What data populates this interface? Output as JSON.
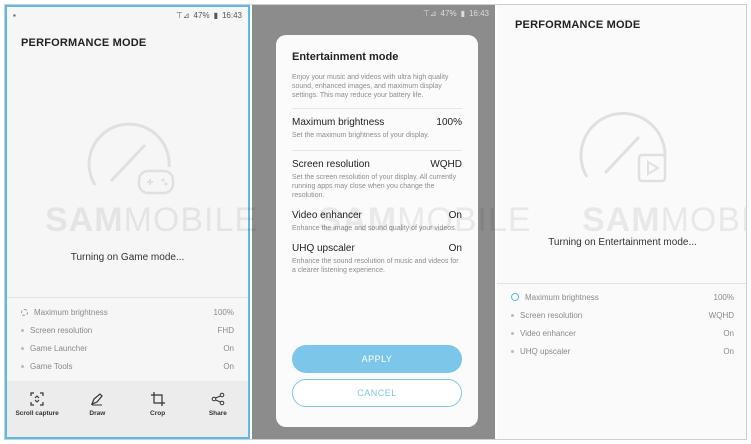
{
  "panel1": {
    "status": {
      "signal": "⊤⊿",
      "battery": "47%",
      "time": "16:43"
    },
    "title": "PERFORMANCE MODE",
    "message": "Turning on Game mode...",
    "list": [
      {
        "label": "Maximum brightness",
        "value": "100%"
      },
      {
        "label": "Screen resolution",
        "value": "FHD"
      },
      {
        "label": "Game Launcher",
        "value": "On"
      },
      {
        "label": "Game Tools",
        "value": "On"
      }
    ],
    "bottom_bar": [
      {
        "label": "Scroll capture",
        "icon": "scroll-capture-icon"
      },
      {
        "label": "Draw",
        "icon": "draw-icon"
      },
      {
        "label": "Crop",
        "icon": "crop-icon"
      },
      {
        "label": "Share",
        "icon": "share-icon"
      }
    ]
  },
  "panel2": {
    "status": {
      "battery": "47%",
      "time": "16:43"
    },
    "dialog": {
      "title": "Entertainment mode",
      "description": "Enjoy your music and videos with ultra high quality sound, enhanced images, and maximum display settings. This may reduce your battery life.",
      "settings": [
        {
          "label": "Maximum brightness",
          "value": "100%",
          "desc": "Set the maximum brightness of your display."
        },
        {
          "label": "Screen resolution",
          "value": "WQHD",
          "desc": "Set the screen resolution of your display. All currently running apps may close when you change the resolution."
        },
        {
          "label": "Video enhancer",
          "value": "On",
          "desc": "Enhance the image and sound quality of your videos."
        },
        {
          "label": "UHQ upscaler",
          "value": "On",
          "desc": "Enhance the sound resolution of music and videos for a clearer listening experience."
        }
      ],
      "apply": "APPLY",
      "cancel": "CANCEL"
    }
  },
  "panel3": {
    "title": "PERFORMANCE MODE",
    "message": "Turning on Entertainment mode...",
    "list": [
      {
        "label": "Maximum brightness",
        "value": "100%"
      },
      {
        "label": "Screen resolution",
        "value": "WQHD"
      },
      {
        "label": "Video enhancer",
        "value": "On"
      },
      {
        "label": "UHQ upscaler",
        "value": "On"
      }
    ]
  },
  "watermark": {
    "bold": "SAM",
    "light": "MOBILE"
  },
  "colors": {
    "accent": "#5bb9e4",
    "button": "#7cc6ea",
    "dim_overlay": "#8c8c8c"
  }
}
